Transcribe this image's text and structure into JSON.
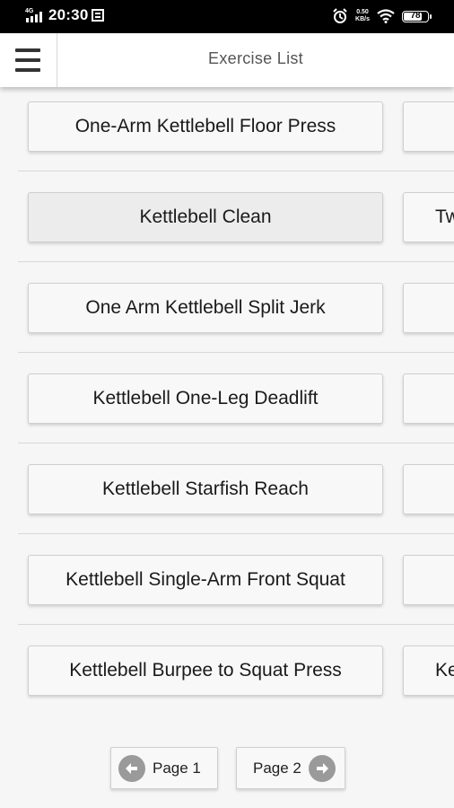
{
  "status_bar": {
    "network": "4G⁶⁶",
    "time": "20:30",
    "speed_value": "0.50",
    "speed_unit": "KB/s",
    "battery": "78",
    "battery_level": 0.78
  },
  "header": {
    "title": "Exercise List"
  },
  "exercises": [
    {
      "label": "One-Arm Kettlebell Floor Press",
      "side": ""
    },
    {
      "label": "Kettlebell Clean",
      "side": "Tw"
    },
    {
      "label": "One Arm Kettlebell Split Jerk",
      "side": ""
    },
    {
      "label": "Kettlebell One-Leg Deadlift",
      "side": ""
    },
    {
      "label": "Kettlebell Starfish Reach",
      "side": ""
    },
    {
      "label": "Kettlebell Single-Arm Front Squat",
      "side": ""
    },
    {
      "label": "Kettlebell Burpee to Squat Press",
      "side": "Ket"
    }
  ],
  "pagination": {
    "prev_label": "Page 1",
    "next_label": "Page 2"
  }
}
